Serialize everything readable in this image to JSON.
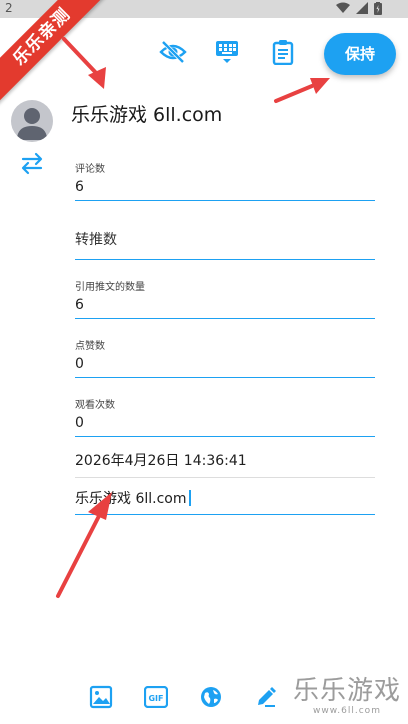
{
  "status_bar": {
    "time": "2"
  },
  "ribbon": {
    "text": "乐乐亲测"
  },
  "toolbar": {
    "save_label": "保持"
  },
  "profile": {
    "name": "乐乐游戏 6ll.com"
  },
  "fields": {
    "comments": {
      "label": "评论数",
      "value": "6"
    },
    "retweets": {
      "placeholder": "转推数"
    },
    "quotes": {
      "label": "引用推文的数量",
      "value": "6"
    },
    "likes": {
      "label": "点赞数",
      "value": "0"
    },
    "views": {
      "label": "观看次数",
      "value": "0"
    },
    "datetime": {
      "value": "2026年4月26日 14:36:41"
    },
    "text": {
      "value": "乐乐游戏 6ll.com"
    }
  },
  "watermark": {
    "big": "乐乐游戏",
    "small": "www.6ll.com"
  },
  "colors": {
    "accent": "#1da1f2",
    "ribbon": "#e33a2e",
    "arrow": "#e84141"
  }
}
